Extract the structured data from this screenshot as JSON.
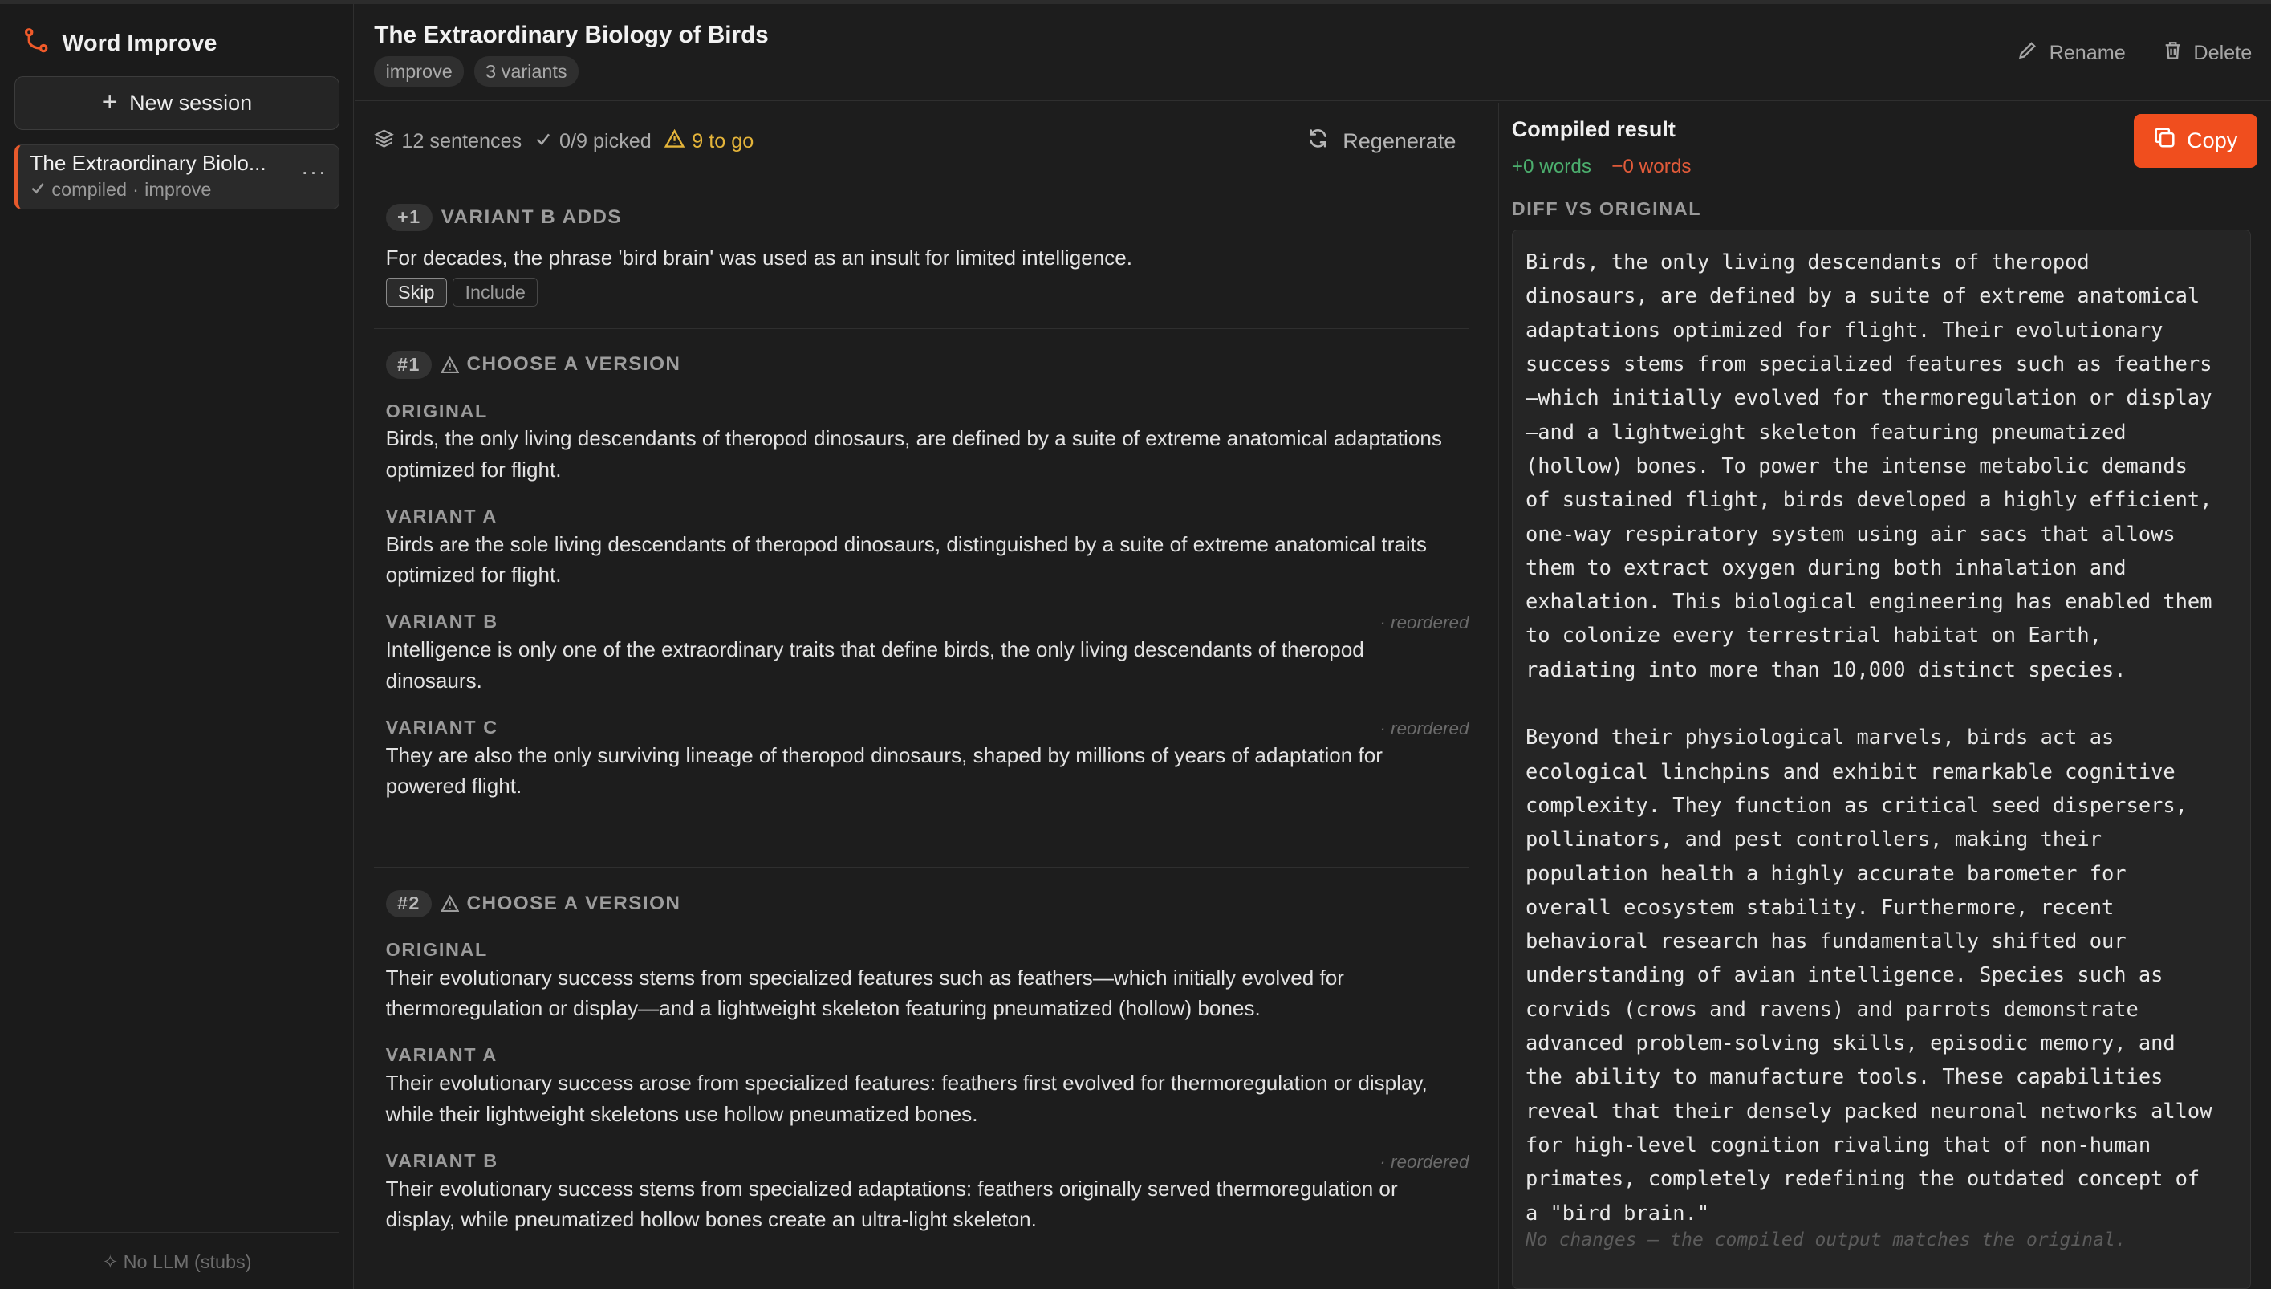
{
  "app": {
    "name": "Word Improve",
    "new_session_label": "New session",
    "footer": "No LLM (stubs)"
  },
  "sessions": [
    {
      "title": "The Extraordinary Biolo...",
      "status": "compiled",
      "mode": "improve"
    }
  ],
  "header": {
    "title": "The Extraordinary Biology of Birds",
    "tags": [
      "improve",
      "3 variants"
    ],
    "rename_label": "Rename",
    "delete_label": "Delete"
  },
  "stats": {
    "sentences": "12 sentences",
    "picked": "0/9 picked",
    "to_go": "9 to go",
    "regenerate_label": "Regenerate"
  },
  "addition": {
    "badge": "+1",
    "heading": "VARIANT B ADDS",
    "text": "For decades, the phrase 'bird brain' was used as an insult for limited intelligence.",
    "skip_label": "Skip",
    "include_label": "Include"
  },
  "choices": [
    {
      "badge": "#1",
      "heading": "CHOOSE A VERSION",
      "options": [
        {
          "label": "ORIGINAL",
          "text": "Birds, the only living descendants of theropod dinosaurs, are defined by a suite of extreme anatomical adaptations optimized for flight.",
          "note": ""
        },
        {
          "label": "VARIANT A",
          "text": "Birds are the sole living descendants of theropod dinosaurs, distinguished by a suite of extreme anatomical traits optimized for flight.",
          "note": ""
        },
        {
          "label": "VARIANT B",
          "text": "Intelligence is only one of the extraordinary traits that define birds, the only living descendants of theropod dinosaurs.",
          "note": "· reordered"
        },
        {
          "label": "VARIANT C",
          "text": "They are also the only surviving lineage of theropod dinosaurs, shaped by millions of years of adaptation for powered flight.",
          "note": "· reordered"
        }
      ]
    },
    {
      "badge": "#2",
      "heading": "CHOOSE A VERSION",
      "options": [
        {
          "label": "ORIGINAL",
          "text": "Their evolutionary success stems from specialized features such as feathers—which initially evolved for thermoregulation or display—and a lightweight skeleton featuring pneumatized (hollow) bones.",
          "note": ""
        },
        {
          "label": "VARIANT A",
          "text": "Their evolutionary success arose from specialized features: feathers first evolved for thermoregulation or display, while their lightweight skeletons use hollow pneumatized bones.",
          "note": ""
        },
        {
          "label": "VARIANT B",
          "text": "Their evolutionary success stems from specialized adaptations: feathers originally served thermoregulation or display, while pneumatized hollow bones create an ultra-light skeleton.",
          "note": "· reordered"
        }
      ]
    }
  ],
  "compiled": {
    "title": "Compiled result",
    "plus_words": "+0 words",
    "minus_words": "−0 words",
    "copy_label": "Copy",
    "diff_label": "DIFF VS ORIGINAL",
    "diff_text": "Birds, the only living descendants of theropod\ndinosaurs, are defined by a suite of extreme anatomical\nadaptations optimized for flight. Their evolutionary\nsuccess stems from specialized features such as feathers\n—which initially evolved for thermoregulation or display\n—and a lightweight skeleton featuring pneumatized\n(hollow) bones. To power the intense metabolic demands\nof sustained flight, birds developed a highly efficient,\none-way respiratory system using air sacs that allows\nthem to extract oxygen during both inhalation and\nexhalation. This biological engineering has enabled them\nto colonize every terrestrial habitat on Earth,\nradiating into more than 10,000 distinct species.\n\nBeyond their physiological marvels, birds act as\necological linchpins and exhibit remarkable cognitive\ncomplexity. They function as critical seed dispersers,\npollinators, and pest controllers, making their\npopulation health a highly accurate barometer for\noverall ecosystem stability. Furthermore, recent\nbehavioral research has fundamentally shifted our\nunderstanding of avian intelligence. Species such as\ncorvids (crows and ravens) and parrots demonstrate\nadvanced problem-solving skills, episodic memory, and\nthe ability to manufacture tools. These capabilities\nreveal that their densely packed neuronal networks allow\nfor high-level cognition rivaling that of non-human\nprimates, completely redefining the outdated concept of\na \"bird brain.\"",
    "no_changes": "No changes — the compiled output matches the original."
  },
  "colors": {
    "accent": "#f04e1e",
    "session_marker": "#e85a2c",
    "warn": "#e4b43a",
    "plus": "#4caf6e",
    "minus": "#e25b3a"
  }
}
